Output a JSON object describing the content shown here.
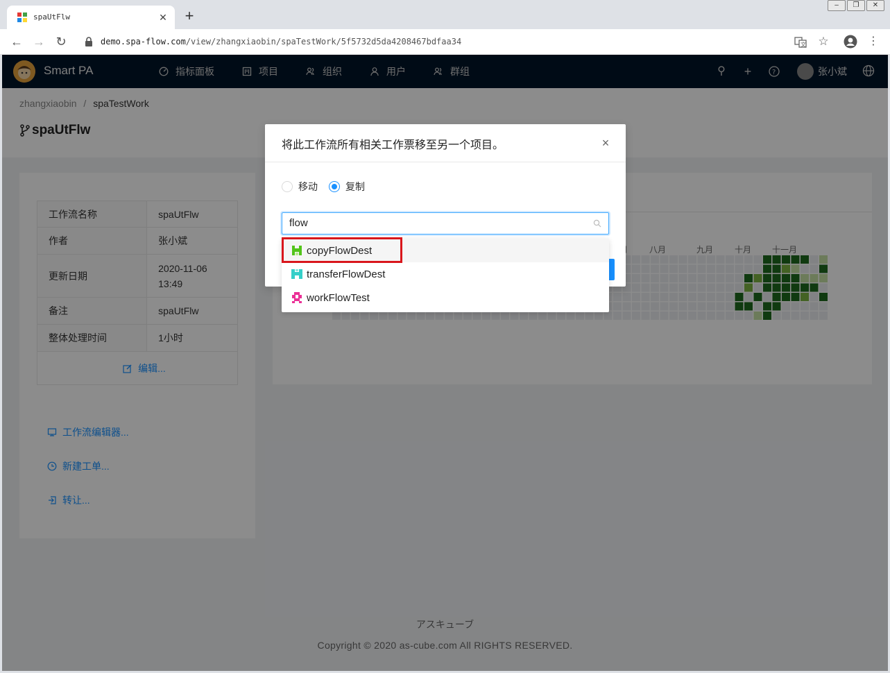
{
  "browser": {
    "tab_title": "spaUtFlw",
    "tab_close": "✕",
    "new_tab": "+",
    "url_host": "demo.spa-flow.com",
    "url_path": "/view/zhangxiaobin/spaTestWork/5f5732d5da4208467bdfaa34"
  },
  "app": {
    "brand": "Smart PA",
    "menu": [
      "指标面板",
      "项目",
      "组织",
      "用户",
      "群组"
    ],
    "username": "张小斌"
  },
  "page": {
    "breadcrumb": [
      "zhangxiaobin",
      "/",
      "spaTestWork"
    ],
    "title": "spaUtFlw",
    "info": [
      {
        "key": "工作流名称",
        "value": "spaUtFlw"
      },
      {
        "key": "作者",
        "value": "张小斌"
      },
      {
        "key": "更新日期",
        "value": "2020-11-06 13:49"
      },
      {
        "key": "备注",
        "value": "spaUtFlw"
      },
      {
        "key": "整体处理时间",
        "value": "1小时"
      }
    ],
    "edit_label": "编辑...",
    "actions": [
      "工作流编辑器...",
      "新建工单...",
      "转让..."
    ],
    "months": [
      "月",
      "八月",
      "九月",
      "十月",
      "十一月"
    ],
    "footer_jp": "アスキューブ",
    "footer_copy": "Copyright © 2020 as-cube.com All RIGHTS RESERVED."
  },
  "modal": {
    "title": "将此工作流所有相关工作票移至另一个项目。",
    "close": "×",
    "radio_move": "移动",
    "radio_copy": "复制",
    "selected_radio": "复制",
    "search_value": "flow",
    "options": [
      "copyFlowDest",
      "transferFlowDest",
      "workFlowTest"
    ]
  },
  "colors": {
    "accent": "#1890ff",
    "header_bg": "#001529",
    "highlight": "#d9161c",
    "heat_dark": "#1e6b1e",
    "heat_mid": "#7cb342",
    "heat_light": "#c5e1a5"
  }
}
